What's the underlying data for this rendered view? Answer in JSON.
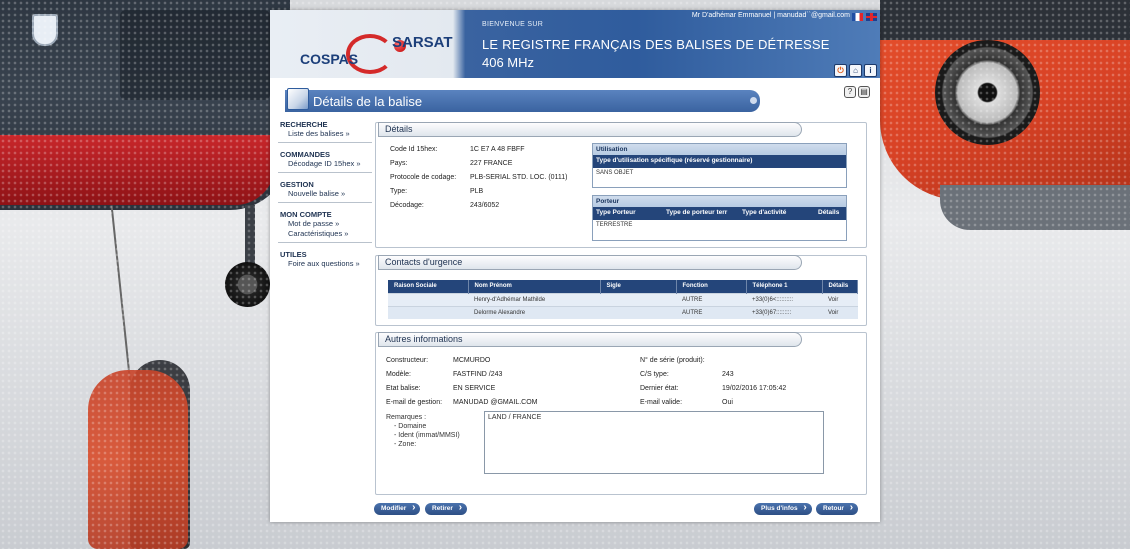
{
  "header": {
    "welcome": "BIENVENUE SUR",
    "title_line1": "LE REGISTRE FRANÇAIS DES BALISES DE DÉTRESSE",
    "title_line2": "406 MHz",
    "user": "Mr D'adhémar Emmanuel | manudad``@gmail.com",
    "logo_left": "COSPAS",
    "logo_right": "SARSAT"
  },
  "page": {
    "title": "Détails de la balise"
  },
  "menu": [
    {
      "title": "RECHERCHE",
      "items": [
        "Liste des balises »"
      ]
    },
    {
      "title": "COMMANDES",
      "items": [
        "Décodage ID 15hex »"
      ]
    },
    {
      "title": "GESTION",
      "items": [
        "Nouvelle balise »"
      ]
    },
    {
      "title": "MON COMPTE",
      "items": [
        "Mot de passe »",
        "Caractéristiques »"
      ]
    },
    {
      "title": "UTILES",
      "items": [
        "Foire aux questions »"
      ]
    }
  ],
  "details": {
    "title": "Détails",
    "fields": [
      {
        "label": "Code Id 15hex:",
        "value": "1C E7 A 48 FBFF"
      },
      {
        "label": "Pays:",
        "value": "227 FRANCE"
      },
      {
        "label": "Protocole de codage:",
        "value": "PLB-SERIAL STD. LOC. (0111)"
      },
      {
        "label": "Type:",
        "value": "PLB"
      },
      {
        "label": "Décodage:",
        "value": "243/6052"
      }
    ],
    "utilisation": {
      "title": "Utilisation",
      "header": "Type d'utilisation spécifique (réservé gestionnaire)",
      "value": "SANS OBJET"
    },
    "porteur": {
      "title": "Porteur",
      "columns": [
        "Type Porteur",
        "Type de porteur terr",
        "Type d'activité",
        "Détails"
      ],
      "row": "TERRESTRE"
    }
  },
  "contacts": {
    "title": "Contacts d'urgence",
    "columns": [
      "Raison Sociale",
      "Nom Prénom",
      "Sigle",
      "Fonction",
      "Téléphone 1",
      "Détails"
    ],
    "rows": [
      {
        "raison": "",
        "nom": "Henry-d'Adhémar Mathilde",
        "sigle": "",
        "fonction": "AUTRE",
        "tel": "+33(0)6<::::::::::",
        "details": "Voir"
      },
      {
        "raison": "",
        "nom": "Delorme Alexandre",
        "sigle": "",
        "fonction": "AUTRE",
        "tel": "+33(0)67:::::::::",
        "details": "Voir"
      }
    ]
  },
  "autres": {
    "title": "Autres informations",
    "left": [
      {
        "label": "Constructeur:",
        "value": "MCMURDO"
      },
      {
        "label": "Modèle:",
        "value": "FASTFIND /243"
      },
      {
        "label": "Etat balise:",
        "value": "EN SERVICE"
      },
      {
        "label": "E-mail de gestion:",
        "value": "MANUDAD    @GMAIL.COM"
      }
    ],
    "right": [
      {
        "label": "N° de série (produit):",
        "value": ""
      },
      {
        "label": "C/S type:",
        "value": "243"
      },
      {
        "label": "Dernier état:",
        "value": "19/02/2016 17:05:42"
      },
      {
        "label": "E-mail valide:",
        "value": "Oui"
      }
    ],
    "remarks_label": "Remarques :",
    "remarks_items": [
      "- Domaine",
      "- Ident (immat/MMSI)",
      "- Zone:"
    ],
    "remarks_value": "LAND / FRANCE"
  },
  "buttons": {
    "modifier": "Modifier",
    "retirer": "Retirer",
    "plus_infos": "Plus d'infos",
    "retour": "Retour"
  }
}
